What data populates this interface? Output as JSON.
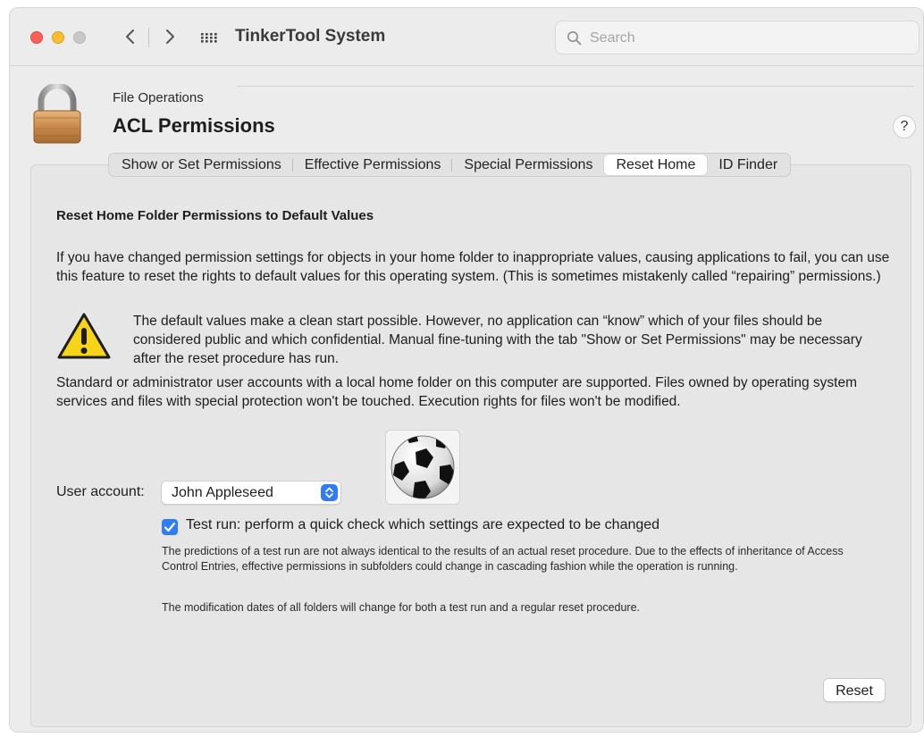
{
  "window": {
    "app_title": "TinkerTool System",
    "search": {
      "placeholder": "Search",
      "value": ""
    }
  },
  "header": {
    "category": "File Operations",
    "title": "ACL Permissions",
    "help_label": "?"
  },
  "tabs": [
    {
      "label": "Show or Set Permissions",
      "active": false
    },
    {
      "label": "Effective Permissions",
      "active": false
    },
    {
      "label": "Special Permissions",
      "active": false
    },
    {
      "label": "Reset Home",
      "active": true
    },
    {
      "label": "ID Finder",
      "active": false
    }
  ],
  "reset_home": {
    "heading": "Reset Home Folder Permissions to Default Values",
    "intro": "If you have changed permission settings for objects in your home folder to inappropriate values, causing applications to fail, you can use this feature to reset the rights to default values for this operating system. (This is sometimes mistakenly called “repairing” permissions.)",
    "warning": "The default values make a clean start possible. However, no application can “know” which of your files should be considered public and which confidential. Manual fine-tuning with the tab \"Show or Set Permissions\" may be necessary after the reset procedure has run.",
    "support_note": "Standard or administrator user accounts with a local home folder on this computer are supported. Files owned by operating system services and files with special protection won't be touched. Execution rights for files won't be modified.",
    "user_account_label": "User account:",
    "user_account_value": "John Appleseed",
    "test_run_label": "Test run: perform a quick check which settings are expected to be changed",
    "test_run_checked": true,
    "test_run_note": "The predictions of a test run are not always identical to the results of an actual reset procedure. Due to the effects of inheritance of Access Control Entries, effective permissions in subfolders could change in cascading fashion while the operation is running.",
    "modification_note": "The modification dates of all folders will change for both a test run and a regular reset procedure.",
    "reset_button": "Reset"
  },
  "icons": {
    "lock": "lock-icon",
    "warning": "warning-icon",
    "avatar": "soccer-ball-avatar",
    "search": "search-icon"
  },
  "colors": {
    "accent": "#2f7cf6",
    "close": "#fe5f57",
    "minimize": "#febc2e",
    "zoom": "#c8c8c8",
    "warning_fill": "#f7d417"
  }
}
